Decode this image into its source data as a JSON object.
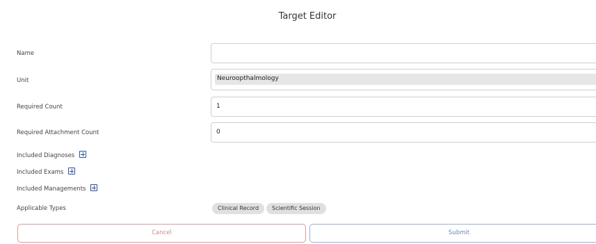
{
  "header": {
    "title": "Target Editor"
  },
  "form": {
    "name": {
      "label": "Name",
      "value": ""
    },
    "unit": {
      "label": "Unit",
      "value": "Neuroopthalmology"
    },
    "required_count": {
      "label": "Required Count",
      "value": "1"
    },
    "required_attachment_count": {
      "label": "Required Attachment Count",
      "value": "0"
    },
    "included_diagnoses": {
      "label": "Included Diagnoses"
    },
    "included_exams": {
      "label": "Included Exams"
    },
    "included_managements": {
      "label": "Included Managements"
    },
    "applicable_types": {
      "label": "Applicable Types",
      "chips": [
        "Clinical Record",
        "Scientific Session"
      ]
    }
  },
  "actions": {
    "cancel_label": "Cancel",
    "submit_label": "Submit"
  },
  "colors": {
    "accent": "#2d4f9a",
    "cancel": "#d99a9a",
    "submit": "#9aaed9"
  }
}
